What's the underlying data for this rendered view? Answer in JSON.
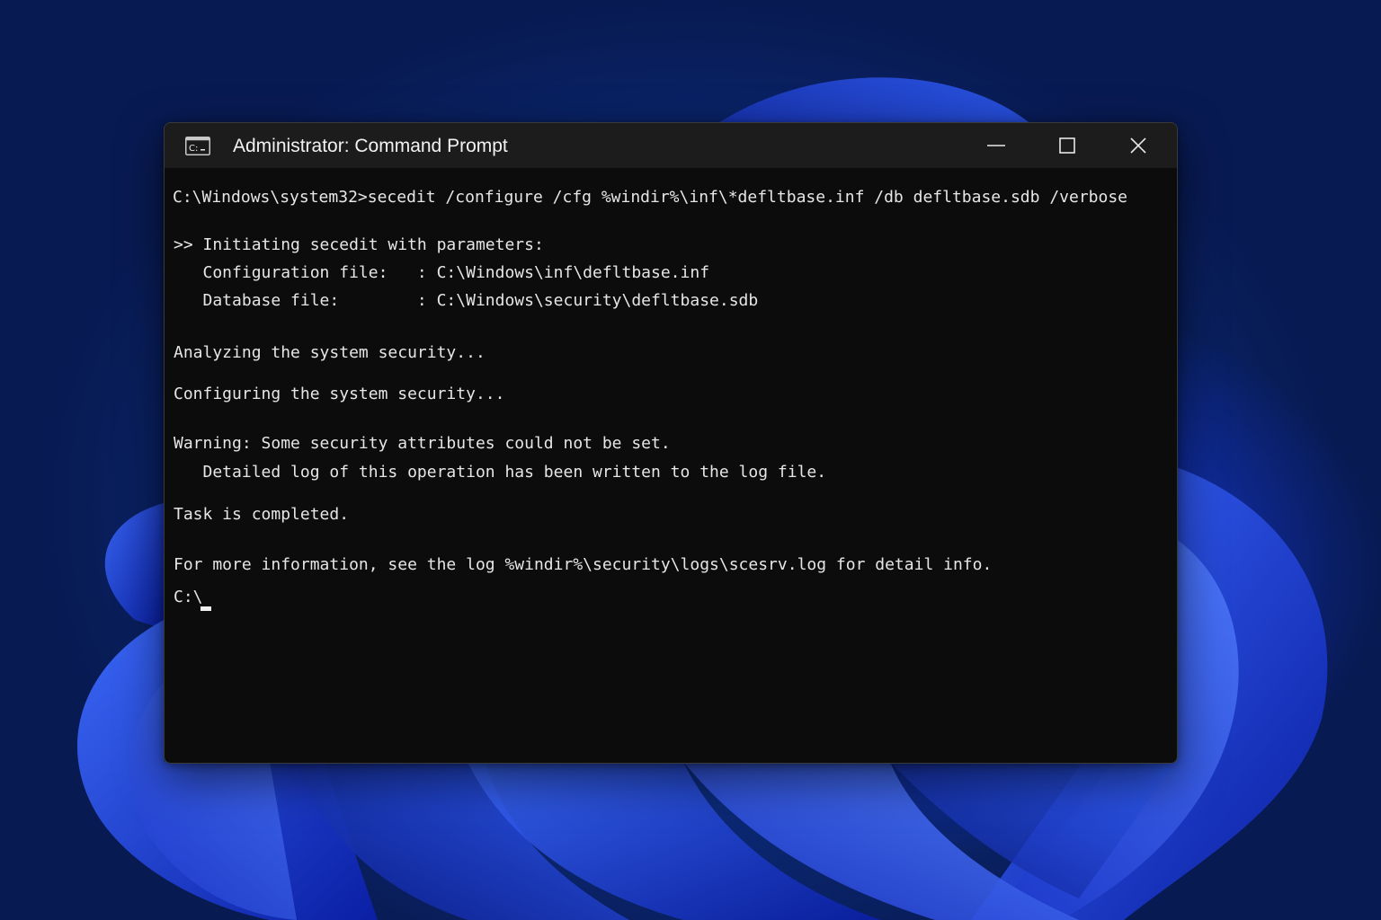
{
  "window": {
    "title": "Administrator: Command Prompt",
    "icon": "cmd-icon",
    "controls": {
      "minimize": "minimize-icon",
      "maximize": "maximize-icon",
      "close": "close-icon"
    }
  },
  "console": {
    "command": "C:\\Windows\\system32>secedit /configure /cfg %windir%\\inf\\*defltbase.inf /db defltbase.sdb /verbose",
    "init": ">> Initiating secedit with parameters:",
    "config_file": "   Configuration file:   : C:\\Windows\\inf\\defltbase.inf",
    "database_file": "   Database file:        : C:\\Windows\\security\\defltbase.sdb",
    "analyzing": "Analyzing the system security...",
    "configuring": "Configuring the system security...",
    "warning": "Warning: Some security attributes could not be set.",
    "detail": "   Detailed log of this operation has been written to the log file.",
    "completed": "Task is completed.",
    "more_info": "For more information, see the log %windir%\\security\\logs\\scesrv.log for detail info.",
    "prompt": "C:\\"
  },
  "colors": {
    "console_bg": "#0c0c0c",
    "titlebar_bg": "#1c1c1c",
    "text": "#e6e6e6",
    "desktop_accent": "#1d3fe0"
  }
}
